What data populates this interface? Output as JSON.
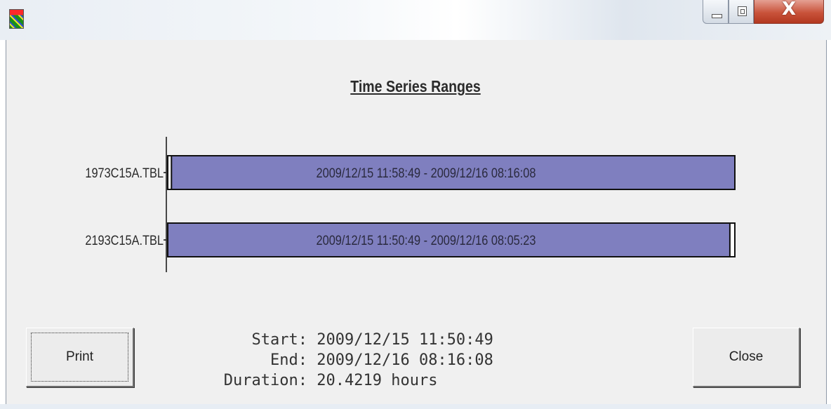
{
  "window": {
    "controls": {
      "minimize_icon": "minimize-icon",
      "maximize_icon": "maximize-icon",
      "close_label": "X"
    },
    "app_icon": "app-icon"
  },
  "chart_title": "Time Series Ranges",
  "chart_data": {
    "type": "gantt",
    "bar_color": "#7f7fbf",
    "rows": [
      {
        "label": "1973C15A.TBL",
        "start": "2009/12/15 11:58:49",
        "end": "2009/12/16 08:16:08",
        "range_text": "2009/12/15 11:58:49 - 2009/12/16 08:16:08"
      },
      {
        "label": "2193C15A.TBL",
        "start": "2009/12/15 11:50:49",
        "end": "2009/12/16 08:05:23",
        "range_text": "2009/12/15 11:50:49 - 2009/12/16 08:05:23"
      }
    ],
    "axis": {
      "start": "2009/12/15 11:50:49",
      "end": "2009/12/16 08:16:08"
    }
  },
  "summary": {
    "start_label": "Start:",
    "start_value": "2009/12/15 11:50:49",
    "end_label": "End:",
    "end_value": "2009/12/16 08:16:08",
    "duration_label": "Duration:",
    "duration_value": "20.4219 hours"
  },
  "buttons": {
    "print": "Print",
    "close": "Close"
  }
}
